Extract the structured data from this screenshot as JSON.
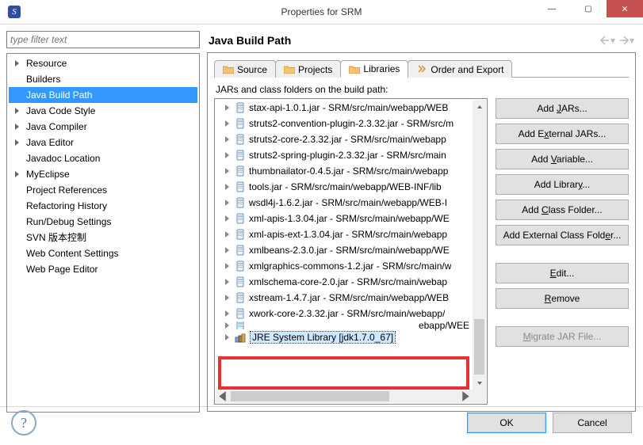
{
  "window": {
    "title": "Properties for SRM"
  },
  "filter_placeholder": "type filter text",
  "sidebar_items": [
    {
      "label": "Resource",
      "expandable": true
    },
    {
      "label": "Builders"
    },
    {
      "label": "Java Build Path",
      "selected": true
    },
    {
      "label": "Java Code Style",
      "expandable": true
    },
    {
      "label": "Java Compiler",
      "expandable": true
    },
    {
      "label": "Java Editor",
      "expandable": true
    },
    {
      "label": "Javadoc Location"
    },
    {
      "label": "MyEclipse",
      "expandable": true
    },
    {
      "label": "Project References"
    },
    {
      "label": "Refactoring History"
    },
    {
      "label": "Run/Debug Settings"
    },
    {
      "label": "SVN 版本控制"
    },
    {
      "label": "Web Content Settings"
    },
    {
      "label": "Web Page Editor"
    }
  ],
  "page_title": "Java Build Path",
  "tabs": [
    {
      "label": "Source"
    },
    {
      "label": "Projects"
    },
    {
      "label": "Libraries",
      "active": true
    },
    {
      "label": "Order and Export"
    }
  ],
  "list_label": "JARs and class folders on the build path:",
  "jars": [
    "stax-api-1.0.1.jar - SRM/src/main/webapp/WEB",
    "struts2-convention-plugin-2.3.32.jar - SRM/src/m",
    "struts2-core-2.3.32.jar - SRM/src/main/webapp",
    "struts2-spring-plugin-2.3.32.jar - SRM/src/main",
    "thumbnailator-0.4.5.jar - SRM/src/main/webapp",
    "tools.jar - SRM/src/main/webapp/WEB-INF/lib",
    "wsdl4j-1.6.2.jar - SRM/src/main/webapp/WEB-I",
    "xml-apis-1.3.04.jar - SRM/src/main/webapp/WE",
    "xml-apis-ext-1.3.04.jar - SRM/src/main/webapp",
    "xmlbeans-2.3.0.jar - SRM/src/main/webapp/WE",
    "xmlgraphics-commons-1.2.jar - SRM/src/main/w",
    "xmlschema-core-2.0.jar - SRM/src/main/webap",
    "xstream-1.4.7.jar - SRM/src/main/webapp/WEB",
    "xwork-core-2.3.32.jar - SRM/src/main/webapp/"
  ],
  "jar_partial": "ebapp/WEE",
  "jre_library": "JRE System Library [jdk1.7.0_67]",
  "buttons": {
    "add_jars": {
      "pre": "Add ",
      "u": "J",
      "post": "ARs..."
    },
    "add_ext_jars": {
      "pre": "Add E",
      "u": "x",
      "post": "ternal JARs..."
    },
    "add_variable": {
      "pre": "Add ",
      "u": "V",
      "post": "ariable..."
    },
    "add_library": {
      "pre": "Add Librar",
      "u": "y",
      "post": "..."
    },
    "add_class_folder": {
      "pre": "Add ",
      "u": "C",
      "post": "lass Folder..."
    },
    "add_ext_class_folder": {
      "pre": "Add External Class Fold",
      "u": "e",
      "post": "r..."
    },
    "edit": {
      "pre": "",
      "u": "E",
      "post": "dit..."
    },
    "remove": {
      "pre": "",
      "u": "R",
      "post": "emove"
    },
    "migrate": {
      "pre": "",
      "u": "M",
      "post": "igrate JAR File..."
    }
  },
  "footer": {
    "ok": "OK",
    "cancel": "Cancel"
  }
}
